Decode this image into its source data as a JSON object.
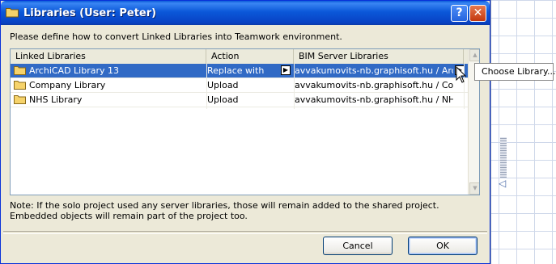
{
  "window": {
    "title": "Libraries (User: Peter)",
    "help_label": "?",
    "close_label": "✕"
  },
  "instruction": "Please define how to convert Linked Libraries into Teamwork environment.",
  "table": {
    "columns": [
      "Linked Libraries",
      "Action",
      "BIM Server Libraries"
    ],
    "rows": [
      {
        "library": "ArchiCAD Library 13",
        "action": "Replace with",
        "server": "avvakumovits-nb.graphisoft.hu / Arc...",
        "selected": true
      },
      {
        "library": "Company Library",
        "action": "Upload",
        "server": "avvakumovits-nb.graphisoft.hu / Co...",
        "selected": false
      },
      {
        "library": "NHS Library",
        "action": "Upload",
        "server": "avvakumovits-nb.graphisoft.hu / NH...",
        "selected": false
      }
    ]
  },
  "note": "Note: If the solo project used any server libraries, those will remain added to the shared project. Embedded objects will remain part of the project too.",
  "buttons": {
    "cancel": "Cancel",
    "ok": "OK"
  },
  "tooltip": "Choose Library...",
  "colors": {
    "titlebar": "#0a5bd8",
    "selection": "#316ac5",
    "dialog_bg": "#ece9d8"
  },
  "icons": {
    "folder": "folder-icon",
    "arrow": "arrow-right-icon"
  }
}
